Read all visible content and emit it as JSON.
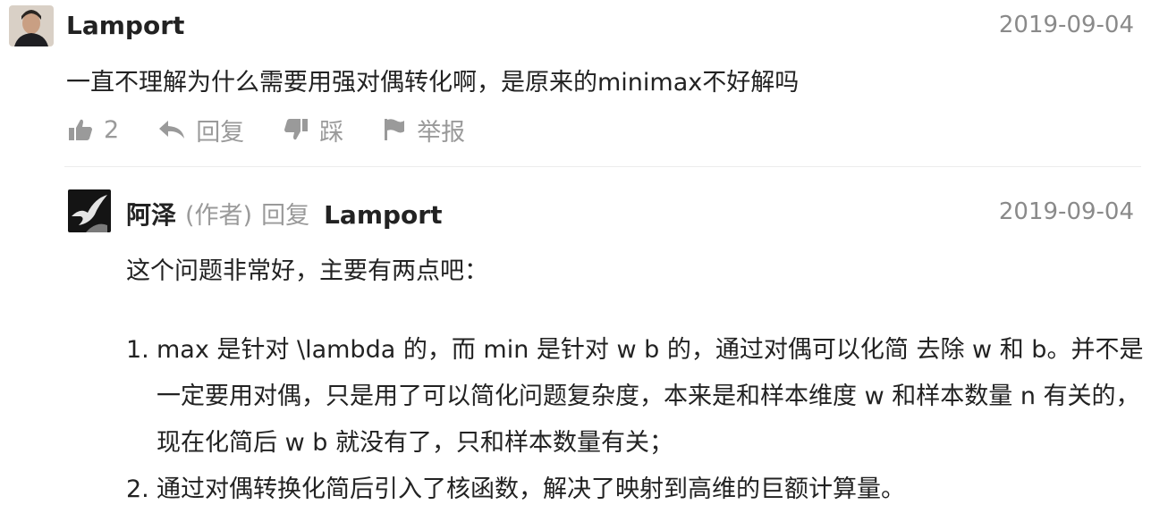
{
  "comment": {
    "author": "Lamport",
    "date": "2019-09-04",
    "text": "一直不理解为什么需要用强对偶转化啊，是原来的minimax不好解吗",
    "actions": {
      "like_count": "2",
      "reply_label": "回复",
      "dislike_label": "踩",
      "report_label": "举报"
    },
    "colors": {
      "text": "#222222",
      "muted": "#9a9a9a",
      "divider": "#ececec"
    },
    "icons": [
      "thumbs-up-icon",
      "reply-arrow-icon",
      "thumbs-down-icon",
      "flag-icon"
    ]
  },
  "reply": {
    "author": "阿泽",
    "author_tag": "(作者)",
    "reply_verb": "回复",
    "target": "Lamport",
    "date": "2019-09-04",
    "intro": "这个问题非常好，主要有两点吧：",
    "items": [
      {
        "num": "1.",
        "text": "max 是针对 \\lambda 的，而 min 是针对 w b 的，通过对偶可以化简 去除 w 和 b。并不是一定要用对偶，只是用了可以简化问题复杂度，本来是和样本维度 w 和样本数量 n 有关的，现在化简后 w b 就没有了，只和样本数量有关；"
      },
      {
        "num": "2.",
        "text": "通过对偶转换化简后引入了核函数，解决了映射到高维的巨额计算量。"
      }
    ]
  }
}
